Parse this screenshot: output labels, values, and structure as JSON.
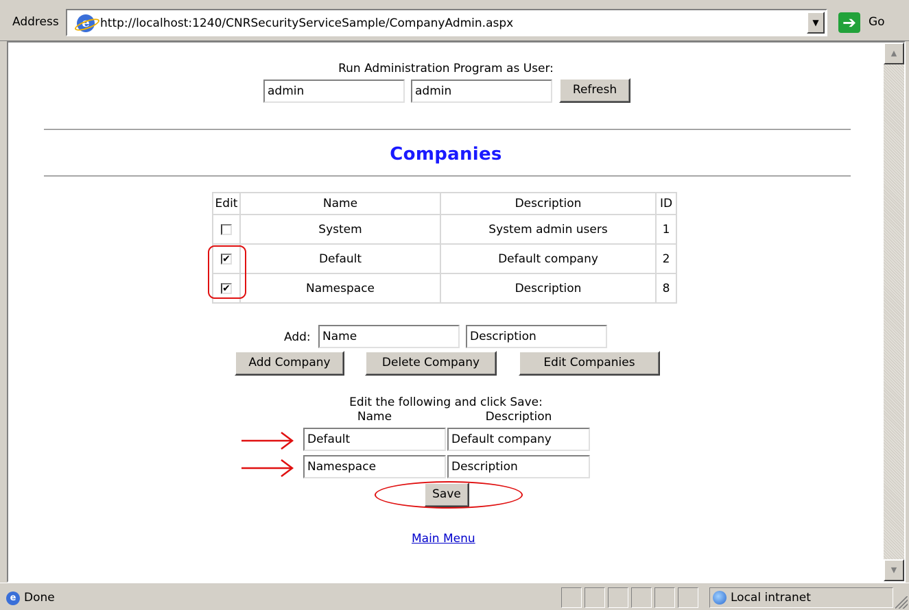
{
  "address_bar": {
    "label": "Address",
    "url": "http://localhost:1240/CNRSecurityServiceSample/CompanyAdmin.aspx",
    "go_label": "Go"
  },
  "run_as": {
    "label": "Run Administration Program as User:",
    "username": "admin",
    "password": "admin",
    "refresh_label": "Refresh"
  },
  "section_title": "Companies",
  "table": {
    "headers": [
      "Edit",
      "Name",
      "Description",
      "ID"
    ],
    "rows": [
      {
        "checked": false,
        "name": "System",
        "description": "System admin users",
        "id": "1"
      },
      {
        "checked": true,
        "name": "Default",
        "description": "Default company",
        "id": "2"
      },
      {
        "checked": true,
        "name": "Namespace",
        "description": "Description",
        "id": "8"
      }
    ]
  },
  "add_form": {
    "label": "Add:",
    "name_value": "Name",
    "description_value": "Description",
    "add_label": "Add Company",
    "delete_label": "Delete Company",
    "edit_label": "Edit Companies"
  },
  "edit_form": {
    "instruction": "Edit the following and click Save:",
    "name_header": "Name",
    "description_header": "Description",
    "rows": [
      {
        "name": "Default",
        "description": "Default company"
      },
      {
        "name": "Namespace",
        "description": "Description"
      }
    ],
    "save_label": "Save"
  },
  "main_menu_link": "Main Menu",
  "status_bar": {
    "status": "Done",
    "zone": "Local intranet"
  },
  "colors": {
    "title": "#1a1aff",
    "annotation": "#e01010",
    "link": "#0000cc"
  }
}
